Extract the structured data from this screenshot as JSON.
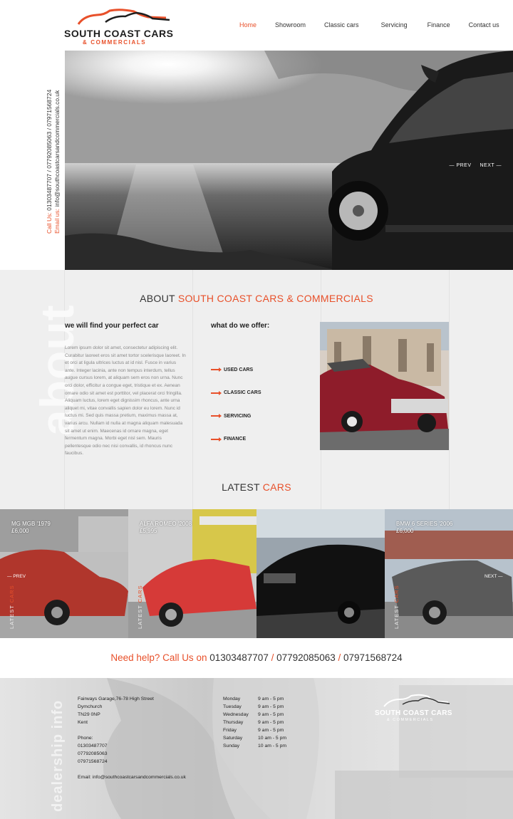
{
  "brand": {
    "name": "SOUTH COAST CARS",
    "sub": "& COMMERCIALS",
    "accent": "#e8502a"
  },
  "nav": {
    "items": [
      "Home",
      "Showroom",
      "Classic cars",
      "Servicing",
      "Finance",
      "Contact us"
    ],
    "active": "Home"
  },
  "contact_vertical": {
    "call_label": "Call Us:",
    "call_value": "01303487707 / 07792085063 / 07971568724",
    "email_label": "Email us:",
    "email_value": "info@southcoastcarsandcommercials.co.uk"
  },
  "hero": {
    "prev": "PREV",
    "next": "NEXT"
  },
  "about": {
    "watermark": "about",
    "title_plain": "ABOUT ",
    "title_accent": "SOUTH COAST CARS & COMMERCIALS",
    "col1_heading": "we will find your perfect car",
    "col1_text": "Lorem ipsum dolor sit amet, consectetur adipiscing elit. Curabitur laoreet eros sit amet tortor scelerisque laoreet. In et orci at ligula ultrices luctus at id nisl. Fusce in varius ante. Integer lacinia, ante non tempus interdum, tellus augue cursus lorem, at aliquam sem eros non urna. Nunc orci dolor, efficitur a congue eget, tristique et ex. Aenean ornare odio sit amet est porttitor, vel placerat orci fringilla. Aliquam luctus, lorem eget dignissim rhoncus, ante urna aliquet mi, vitae convallis sapien dolor eu lorem. Nunc id luctus mi. Sed quis massa pretium, maximus massa at, varius arcu. Nullam id nulla at magna aliquam malesuada sit amet ut enim. Maecenas id ornare magna, eget fermentum magna. Morbi eget nisl sem. Mauris pellentesque odio nec nisi convallis, id rhoncus nunc faucibus.",
    "col2_heading": "what do we offer:",
    "offers": [
      "USED CARS",
      "CLASSIC CARS",
      "SERVICING",
      "FINANCE"
    ]
  },
  "latest": {
    "title_plain": "LATEST ",
    "title_accent": "CARS",
    "label_word1": "LATEST",
    "label_word2": "CARS",
    "prev": "PREV",
    "next": "NEXT",
    "cars": [
      {
        "name": "MG MGB '1979",
        "price": "£6,000"
      },
      {
        "name": "ALFA ROMEO '2008",
        "price": "£5,995"
      },
      {
        "name": "",
        "price": ""
      },
      {
        "name": "BMW 6 SERIES '2006",
        "price": "£6,000"
      }
    ]
  },
  "callband": {
    "prefix": "Need help? Call Us on",
    "numbers": [
      "01303487707",
      "07792085063",
      "07971568724"
    ],
    "separator": "/"
  },
  "footer": {
    "watermark": "dealership info",
    "address_lines": [
      "Fairways Garage,76-78 High Street",
      "Dymchurch",
      "TN29 0NP",
      "Kent"
    ],
    "phone_label": "Phone:",
    "phones": [
      "01303487707",
      "07792085063",
      "07971568724"
    ],
    "email_line": "Email: info@southcoastcarsandcommercials.co.uk",
    "hours": [
      {
        "day": "Monday",
        "time": "9 am - 5 pm"
      },
      {
        "day": "Tuesday",
        "time": "9 am - 5 pm"
      },
      {
        "day": "Wednesday",
        "time": "9 am - 5 pm"
      },
      {
        "day": "Thursday",
        "time": "9 am - 5 pm"
      },
      {
        "day": "Friday",
        "time": "9 am - 5 pm"
      },
      {
        "day": "Saturday",
        "time": "10 am - 5 pm"
      },
      {
        "day": "Sunday",
        "time": "10 am - 5 pm"
      }
    ]
  }
}
